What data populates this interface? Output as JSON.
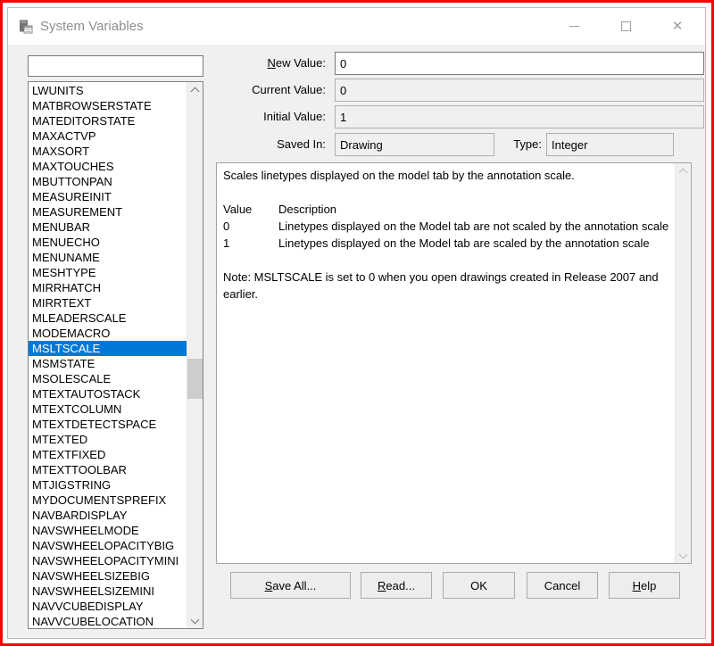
{
  "window": {
    "title": "System Variables",
    "controls": {
      "minimize": "minimize",
      "maximize": "maximize",
      "close": "✕"
    }
  },
  "filter": {
    "value": ""
  },
  "variable_list": {
    "selected": "MSLTSCALE",
    "items": [
      "LWUNITS",
      "MATBROWSERSTATE",
      "MATEDITORSTATE",
      "MAXACTVP",
      "MAXSORT",
      "MAXTOUCHES",
      "MBUTTONPAN",
      "MEASUREINIT",
      "MEASUREMENT",
      "MENUBAR",
      "MENUECHO",
      "MENUNAME",
      "MESHTYPE",
      "MIRRHATCH",
      "MIRRTEXT",
      "MLEADERSCALE",
      "MODEMACRO",
      "MSLTSCALE",
      "MSMSTATE",
      "MSOLESCALE",
      "MTEXTAUTOSTACK",
      "MTEXTCOLUMN",
      "MTEXTDETECTSPACE",
      "MTEXTED",
      "MTEXTFIXED",
      "MTEXTTOOLBAR",
      "MTJIGSTRING",
      "MYDOCUMENTSPREFIX",
      "NAVBARDISPLAY",
      "NAVSWHEELMODE",
      "NAVSWHEELOPACITYBIG",
      "NAVSWHEELOPACITYMINI",
      "NAVSWHEELSIZEBIG",
      "NAVSWHEELSIZEMINI",
      "NAVVCUBEDISPLAY",
      "NAVVCUBELOCATION"
    ]
  },
  "fields": {
    "new_value": {
      "mn": "N",
      "rest": "ew Value:",
      "value": "0"
    },
    "current_value": {
      "label": "Current Value:",
      "value": "0"
    },
    "initial_value": {
      "label": "Initial Value:",
      "value": "1"
    },
    "saved_in": {
      "label": "Saved In:",
      "value": "Drawing"
    },
    "type": {
      "label": "Type:",
      "value": "Integer"
    }
  },
  "description": {
    "summary": "Scales linetypes displayed on the model tab by the annotation scale.",
    "table": {
      "headers": [
        "Value",
        "Description"
      ],
      "rows": [
        [
          "0",
          "Linetypes displayed on the Model tab are not scaled by the annotation scale"
        ],
        [
          "1",
          "Linetypes displayed on the Model tab are scaled by the annotation scale"
        ]
      ]
    },
    "note": "Note: MSLTSCALE is set to 0 when you open drawings created in Release 2007 and earlier."
  },
  "buttons": [
    {
      "mn": "S",
      "rest": "ave All..."
    },
    {
      "mn": "R",
      "rest": "ead..."
    },
    {
      "mn": "",
      "rest": "OK"
    },
    {
      "mn": "",
      "rest": "Cancel"
    },
    {
      "mn": "H",
      "rest": "elp"
    }
  ],
  "colors": {
    "selection_bg": "#0078d7",
    "selection_text": "#ffffff",
    "frame": "#ff0000"
  }
}
